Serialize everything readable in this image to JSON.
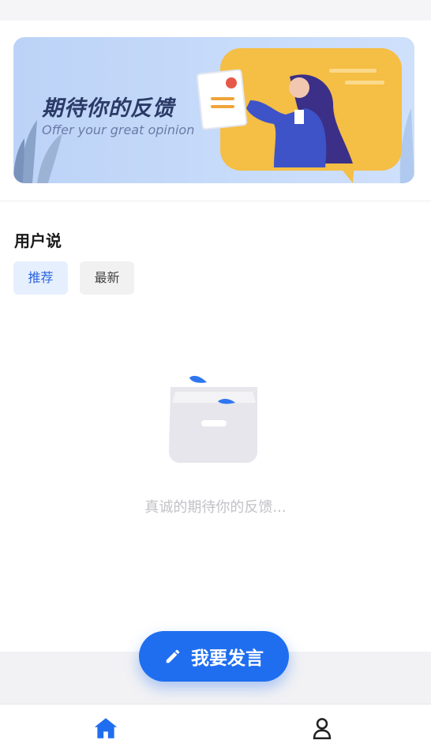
{
  "banner": {
    "title": "期待你的反馈",
    "subtitle": "Offer your great opinion"
  },
  "section": {
    "title": "用户说",
    "tabs": [
      {
        "label": "推荐",
        "active": true
      },
      {
        "label": "最新",
        "active": false
      }
    ]
  },
  "empty_state": {
    "text": "真诚的期待你的反馈..."
  },
  "fab": {
    "label": "我要发言"
  },
  "tabbar": {
    "items": [
      {
        "icon": "home-icon",
        "active": true
      },
      {
        "icon": "user-icon",
        "active": false
      }
    ]
  },
  "colors": {
    "primary": "#1f6ef0",
    "banner_bg": "#c7dbfa",
    "empty_text": "#c2c2c7"
  }
}
